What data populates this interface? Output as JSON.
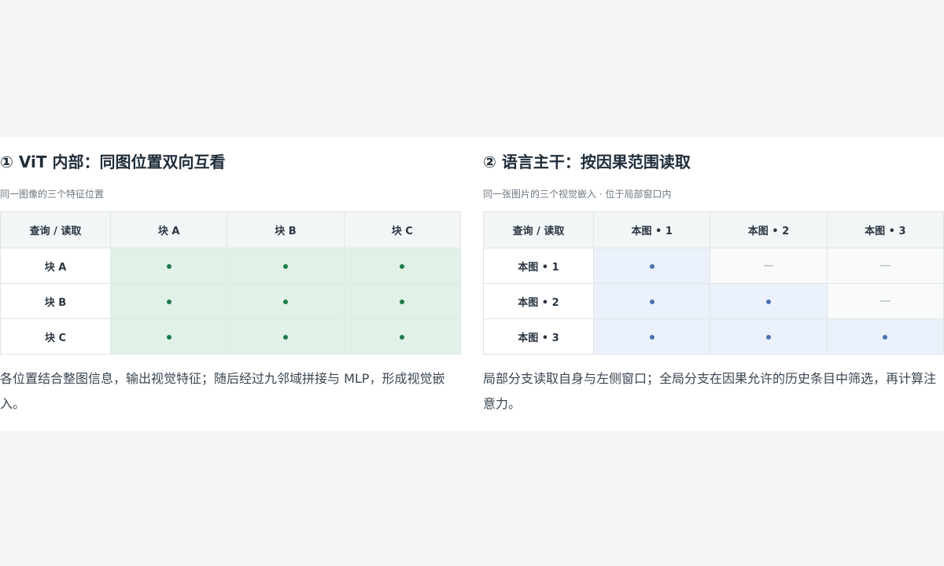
{
  "left": {
    "title": "① ViT 内部：同图位置双向互看",
    "subtitle": "同一图像的三个特征位置",
    "corner": "查询 / 读取",
    "cols": [
      "块 A",
      "块 B",
      "块 C"
    ],
    "rows": [
      {
        "label": "块 A",
        "cells": [
          "dot",
          "dot",
          "dot"
        ]
      },
      {
        "label": "块 B",
        "cells": [
          "dot",
          "dot",
          "dot"
        ]
      },
      {
        "label": "块 C",
        "cells": [
          "dot",
          "dot",
          "dot"
        ]
      }
    ],
    "description": "各位置结合整图信息，输出视觉特征；随后经过九邻域拼接与 MLP，形成视觉嵌入。",
    "accent": "#1e7a4a"
  },
  "right": {
    "title": "② 语言主干：按因果范围读取",
    "subtitle": "同一张图片的三个视觉嵌入 · 位于局部窗口内",
    "corner": "查询 / 读取",
    "cols": [
      "本图 • 1",
      "本图 • 2",
      "本图 • 3"
    ],
    "rows": [
      {
        "label": "本图 • 1",
        "cells": [
          "dot",
          "dash",
          "dash"
        ]
      },
      {
        "label": "本图 • 2",
        "cells": [
          "dot",
          "dot",
          "dash"
        ]
      },
      {
        "label": "本图 • 3",
        "cells": [
          "dot",
          "dot",
          "dot"
        ]
      }
    ],
    "dash_glyph": "—",
    "description": "局部分支读取自身与左侧窗口；全局分支在因果允许的历史条目中筛选，再计算注意力。",
    "accent": "#4a72b0"
  }
}
